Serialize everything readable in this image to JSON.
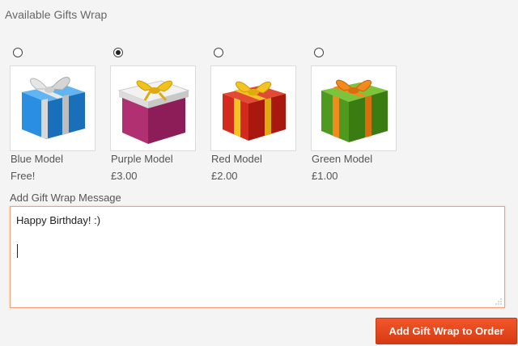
{
  "title": "Available Gifts Wrap",
  "options": [
    {
      "name": "Blue Model",
      "price": "Free!",
      "selected": false,
      "icon": "blue-gift-box-icon",
      "color": "#2a8fe0"
    },
    {
      "name": "Purple Model",
      "price": "£3.00",
      "selected": true,
      "icon": "purple-gift-box-icon",
      "color": "#b03072"
    },
    {
      "name": "Red Model",
      "price": "£2.00",
      "selected": false,
      "icon": "red-gift-box-icon",
      "color": "#d32a1e"
    },
    {
      "name": "Green Model",
      "price": "£1.00",
      "selected": false,
      "icon": "green-gift-box-icon",
      "color": "#4f9a1e"
    }
  ],
  "message": {
    "label": "Add Gift Wrap Message",
    "value": "Happy Birthday! :)"
  },
  "submit_label": "Add Gift Wrap to Order",
  "colors": {
    "accent": "#e2461b",
    "focus_border": "#f0a07a"
  }
}
